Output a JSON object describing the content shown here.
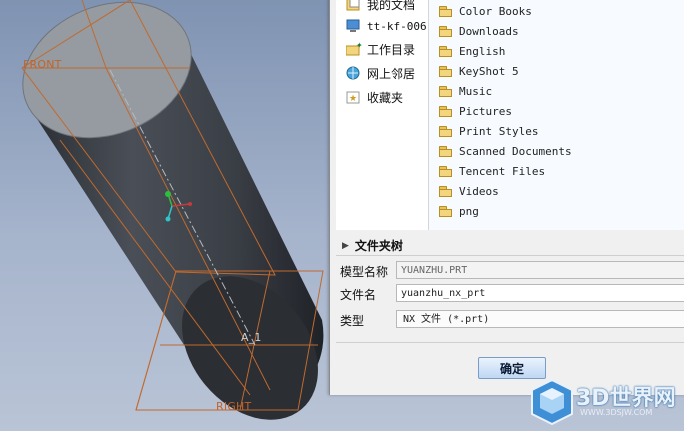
{
  "viewport": {
    "datum_front": "FRONT",
    "datum_right": "RIGHT",
    "axis_label": "A_1"
  },
  "dialog": {
    "places": [
      {
        "label": "我的文档",
        "icon": "documents-icon"
      },
      {
        "label": "tt-kf-006",
        "icon": "computer-icon"
      },
      {
        "label": "工作目录",
        "icon": "working-directory-icon"
      },
      {
        "label": "网上邻居",
        "icon": "network-icon"
      },
      {
        "label": "收藏夹",
        "icon": "favorites-icon"
      }
    ],
    "folders": [
      "Color Books",
      "Downloads",
      "English",
      "KeyShot 5",
      "Music",
      "Pictures",
      "Print Styles",
      "Scanned Documents",
      "Tencent Files",
      "Videos",
      "png"
    ],
    "folder_tree_label": "文件夹树",
    "model_name_label": "模型名称",
    "model_name_value": "YUANZHU.PRT",
    "file_name_label": "文件名",
    "file_name_value": "yuanzhu_nx_prt",
    "type_label": "类型",
    "type_value": "NX 文件 (*.prt)",
    "ok_label": "确定"
  },
  "watermark": {
    "text": "3D世界网",
    "url": "WWW.3DSJW.COM"
  }
}
